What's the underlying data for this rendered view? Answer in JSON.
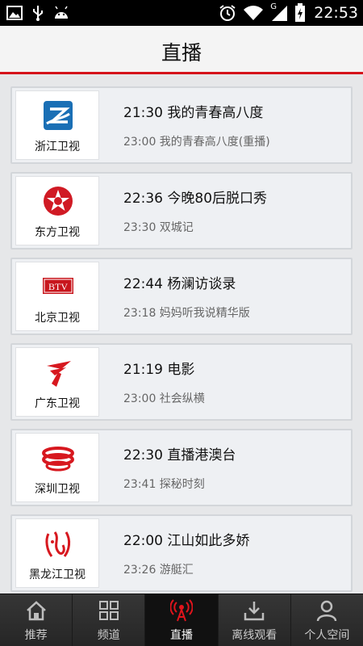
{
  "status_bar": {
    "time": "22:53",
    "network_label": "G",
    "left_icons": [
      "gallery-icon",
      "usb-icon",
      "android-icon"
    ],
    "right_icons": [
      "alarm-icon",
      "wifi-icon",
      "signal-icon",
      "battery-icon"
    ]
  },
  "header": {
    "title": "直播"
  },
  "channels": [
    {
      "name": "浙江卫视",
      "icon": "zhejiang-logo",
      "now": "21:30 我的青春高八度",
      "next": "23:00 我的青春高八度(重播)"
    },
    {
      "name": "东方卫视",
      "icon": "dongfang-logo",
      "now": "22:36 今晚80后脱口秀",
      "next": "23:30 双城记"
    },
    {
      "name": "北京卫视",
      "icon": "btv-logo",
      "logo_text": "BTV",
      "now": "22:44 杨澜访谈录",
      "next": "23:18 妈妈听我说精华版"
    },
    {
      "name": "广东卫视",
      "icon": "guangdong-logo",
      "now": "21:19 电影",
      "next": "23:00 社会纵横"
    },
    {
      "name": "深圳卫视",
      "icon": "shenzhen-logo",
      "now": "22:30 直播港澳台",
      "next": "23:41 探秘时刻"
    },
    {
      "name": "黑龙江卫视",
      "icon": "heilongjiang-logo",
      "now": "22:00 江山如此多娇",
      "next": "23:26 游艇汇"
    }
  ],
  "tabs": [
    {
      "label": "推荐",
      "icon": "home-icon",
      "active": false
    },
    {
      "label": "频道",
      "icon": "grid-icon",
      "active": false
    },
    {
      "label": "直播",
      "icon": "broadcast-icon",
      "active": true
    },
    {
      "label": "离线观看",
      "icon": "download-icon",
      "active": false
    },
    {
      "label": "个人空间",
      "icon": "user-icon",
      "active": false
    }
  ],
  "colors": {
    "accent": "#d5131b",
    "tabbar": "#2a2a2a",
    "card_bg": "#eef0f3",
    "page_bg": "#e6e7e9"
  }
}
